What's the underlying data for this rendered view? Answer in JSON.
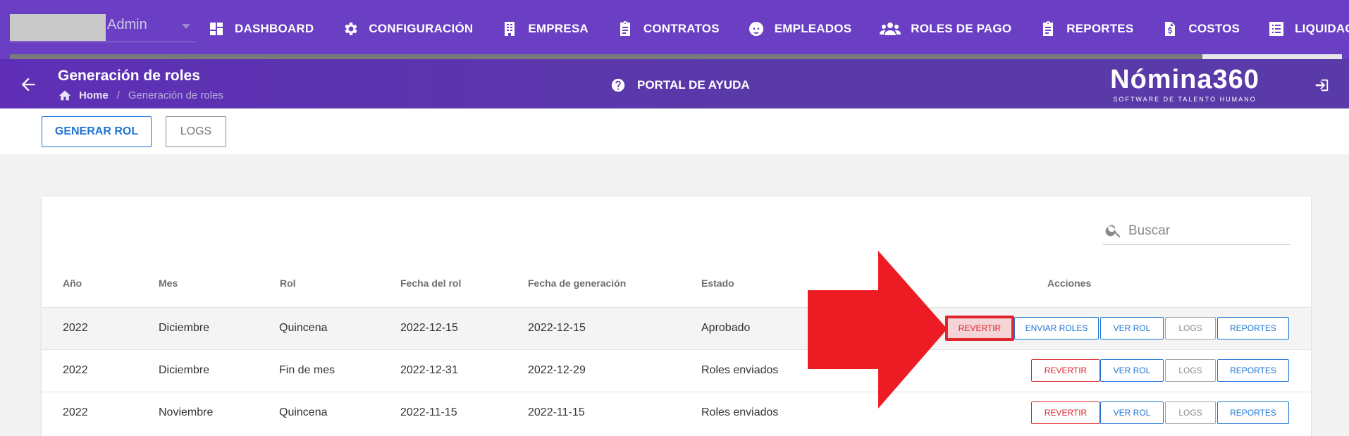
{
  "topnav": {
    "user_name": "Admin",
    "menu": [
      {
        "label": "DASHBOARD",
        "icon": "dashboard-icon"
      },
      {
        "label": "CONFIGURACIÓN",
        "icon": "gear-icon"
      },
      {
        "label": "EMPRESA",
        "icon": "building-icon"
      },
      {
        "label": "CONTRATOS",
        "icon": "clipboard-icon"
      },
      {
        "label": "EMPLEADOS",
        "icon": "face-icon"
      },
      {
        "label": "ROLES DE PAGO",
        "icon": "people-icon"
      },
      {
        "label": "REPORTES",
        "icon": "clipboard-list-icon"
      },
      {
        "label": "COSTOS",
        "icon": "file-dollar-icon"
      },
      {
        "label": "LIQUIDACIONES",
        "icon": "list-icon"
      }
    ]
  },
  "subheader": {
    "title": "Generación de roles",
    "breadcrumb_home": "Home",
    "breadcrumb_sep": "/",
    "breadcrumb_current": "Generación de roles",
    "help_label": "PORTAL DE AYUDA",
    "brand_name": "Nómina360",
    "brand_tagline": "SOFTWARE DE TALENTO HUMANO"
  },
  "actions": {
    "generar_label": "GENERAR ROL",
    "logs_label": "LOGS"
  },
  "search": {
    "placeholder": "Buscar"
  },
  "table": {
    "headers": [
      "Año",
      "Mes",
      "Rol",
      "Fecha del rol",
      "Fecha de generación",
      "Estado",
      "Acciones"
    ],
    "rows": [
      {
        "anio": "2022",
        "mes": "Diciembre",
        "rol": "Quincena",
        "fecha_rol": "2022-12-15",
        "fecha_gen": "2022-12-15",
        "estado": "Aprobado",
        "buttons": {
          "revertir": "REVERTIR",
          "enviar": "ENVIAR ROLES",
          "ver": "VER ROL",
          "logs": "LOGS",
          "reportes": "REPORTES"
        }
      },
      {
        "anio": "2022",
        "mes": "Diciembre",
        "rol": "Fin de mes",
        "fecha_rol": "2022-12-31",
        "fecha_gen": "2022-12-29",
        "estado": "Roles enviados",
        "buttons": {
          "revertir": "REVERTIR",
          "ver": "VER ROL",
          "logs": "LOGS",
          "reportes": "REPORTES"
        }
      },
      {
        "anio": "2022",
        "mes": "Noviembre",
        "rol": "Quincena",
        "fecha_rol": "2022-11-15",
        "fecha_gen": "2022-11-15",
        "estado": "Roles enviados",
        "buttons": {
          "revertir": "REVERTIR",
          "ver": "VER ROL",
          "logs": "LOGS",
          "reportes": "REPORTES"
        }
      }
    ]
  },
  "colors": {
    "nav_purple": "#6a3fc4",
    "primary_blue": "#1e74d6",
    "danger_red": "#e0252f",
    "annotation_red": "#ed1c24"
  }
}
